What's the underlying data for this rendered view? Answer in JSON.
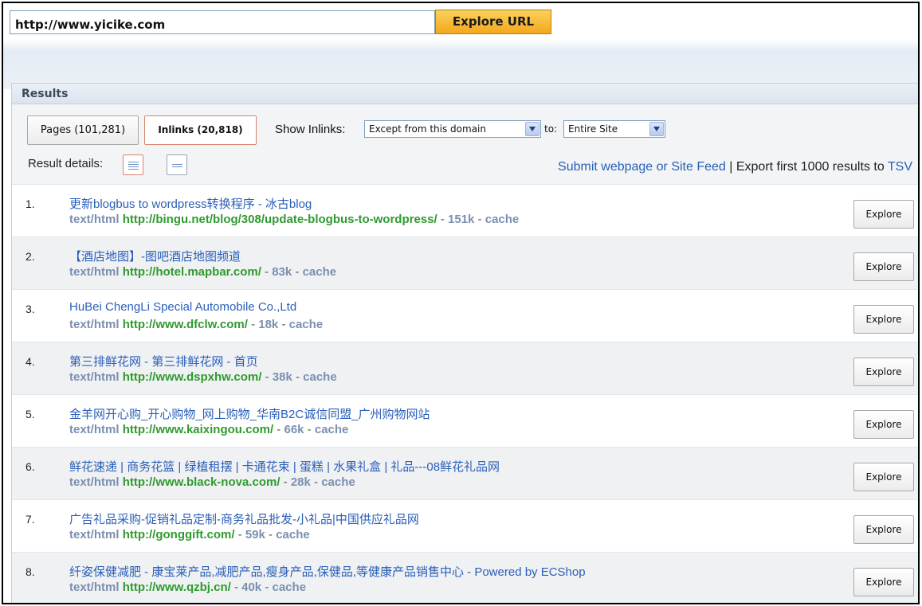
{
  "url_bar": {
    "value": "http://www.yicike.com",
    "button_label": "Explore URL"
  },
  "results": {
    "header": "Results",
    "tabs": [
      {
        "label": "Pages (101,281)",
        "active": false
      },
      {
        "label": "Inlinks (20,818)",
        "active": true
      }
    ],
    "show_inlinks_label": "Show Inlinks:",
    "from_select_value": "Except from this domain",
    "to_label": "to:",
    "to_select_value": "Entire Site",
    "result_details_label": "Result details:",
    "submit_link": "Submit webpage or Site Feed",
    "export_text": " | Export first 1000 results to ",
    "tsv_link": "TSV",
    "explore_label": "Explore",
    "items": [
      {
        "num": "1.",
        "title": "更新blogbus to wordpress转换程序 - 冰古blog",
        "mime": "text/html",
        "url": "http://bingu.net/blog/308/update-blogbus-to-wordpress/",
        "size": "151k",
        "cache": "cache"
      },
      {
        "num": "2.",
        "title": "【酒店地图】-图吧酒店地图频道",
        "mime": "text/html",
        "url": "http://hotel.mapbar.com/",
        "size": "83k",
        "cache": "cache"
      },
      {
        "num": "3.",
        "title": "HuBei ChengLi Special Automobile Co.,Ltd",
        "mime": "text/html",
        "url": "http://www.dfclw.com/",
        "size": "18k",
        "cache": "cache"
      },
      {
        "num": "4.",
        "title": "第三排鲜花网 - 第三排鲜花网 - 首页",
        "mime": "text/html",
        "url": "http://www.dspxhw.com/",
        "size": "38k",
        "cache": "cache"
      },
      {
        "num": "5.",
        "title": "金羊网开心购_开心购物_网上购物_华南B2C诚信同盟_广州购物网站",
        "mime": "text/html",
        "url": "http://www.kaixingou.com/",
        "size": "66k",
        "cache": "cache"
      },
      {
        "num": "6.",
        "title": "鲜花速递 | 商务花篮 | 绿植租摆 | 卡通花束 | 蛋糕 | 水果礼盒 | 礼品---08鲜花礼品网",
        "mime": "text/html",
        "url": "http://www.black-nova.com/",
        "size": "28k",
        "cache": "cache"
      },
      {
        "num": "7.",
        "title": "广告礼品采购-促销礼品定制-商务礼品批发-小礼品|中国供应礼品网",
        "mime": "text/html",
        "url": "http://gonggift.com/",
        "size": "59k",
        "cache": "cache"
      },
      {
        "num": "8.",
        "title": "纤姿保健减肥 - 康宝莱产品,减肥产品,瘦身产品,保健品,等健康产品销售中心 - Powered by ECShop",
        "mime": "text/html",
        "url": "http://www.qzbj.cn/",
        "size": "40k",
        "cache": "cache"
      }
    ]
  },
  "colors": {
    "link": "#2a5fb8",
    "url_green": "#2f9a2f",
    "meta_gray": "#7b8fb0",
    "explore_url_btn": "#f3a81d"
  }
}
